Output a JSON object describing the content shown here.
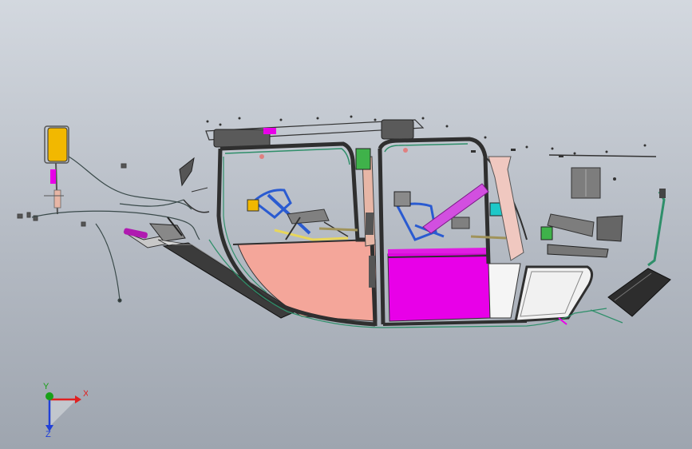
{
  "viewport": {
    "view_name": "helicopter-cabin-frame-assembly",
    "background_top": "#d3d8df",
    "background_bottom": "#9ea5af"
  },
  "colors": {
    "frame": "#3a3a3a",
    "frame_green": "#2f8f6a",
    "panel_pink": "#f4a69a",
    "panel_magenta": "#e800e8",
    "accent_blue": "#2a5bd1",
    "part_grey": "#7d7d7d",
    "part_yellow": "#f2b800",
    "part_tan": "#e7b6a6",
    "part_cyan": "#1ec8c8",
    "part_green": "#3fb24a"
  },
  "triad": {
    "x_label": "X",
    "y_label": "Y",
    "z_label": "Z",
    "x_color": "#e02020",
    "y_color": "#18a018",
    "z_color": "#2040d8"
  }
}
